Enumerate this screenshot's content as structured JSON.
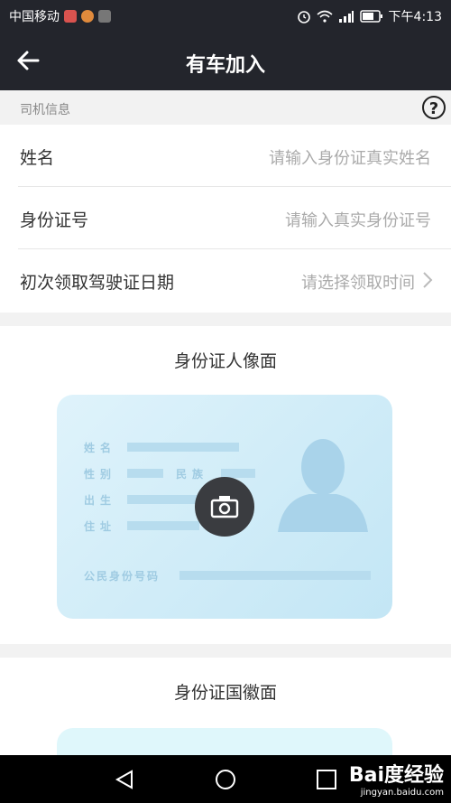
{
  "status_bar": {
    "carrier": "中国移动",
    "time": "下午4:13",
    "icons": [
      "alarm-icon",
      "wifi-icon",
      "signal-icon",
      "battery-icon"
    ]
  },
  "header": {
    "title": "有车加入",
    "back_icon": "arrow-left-icon"
  },
  "section": {
    "label": "司机信息",
    "help_glyph": "?"
  },
  "form": {
    "rows": [
      {
        "label": "姓名",
        "placeholder": "请输入身份证真实姓名"
      },
      {
        "label": "身份证号",
        "placeholder": "请输入真实身份证号"
      },
      {
        "label": "初次领取驾驶证日期",
        "placeholder": "请选择领取时间"
      }
    ]
  },
  "id_front": {
    "caption": "身份证人像面",
    "fields": [
      "姓名",
      "性别",
      "民族",
      "出生",
      "住址",
      "公民身份号码"
    ]
  },
  "id_back": {
    "caption": "身份证国徽面"
  },
  "watermark": {
    "brand": "Bai度经验",
    "url": "jingyan.baidu.com"
  },
  "colors": {
    "topbar": "#23252c",
    "placeholder": "#aaaaaa",
    "card_light": "#dff3fb",
    "card_bar": "#b7dcee"
  }
}
